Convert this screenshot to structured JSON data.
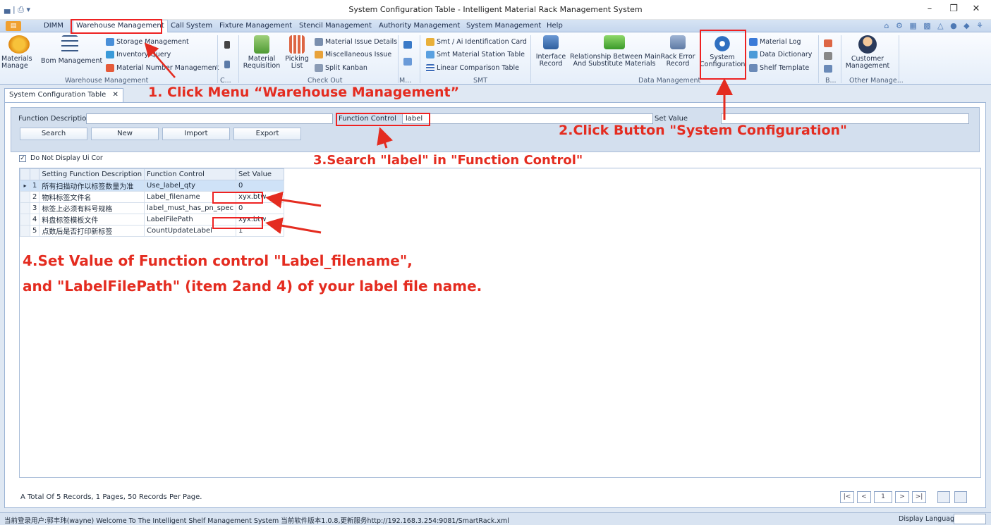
{
  "window": {
    "title": "System Configuration Table - Intelligent Material Rack Management System",
    "quick_access": "▄ | ⎙ ▾",
    "minimize": "–",
    "maximize": "❐",
    "close": "✕"
  },
  "menu": {
    "file": "▤",
    "items": [
      "DIMM",
      "Warehouse Management",
      "Call System",
      "Fixture Management",
      "Stencil Management",
      "Authority Management",
      "System Management",
      "Help"
    ],
    "right_icons": "⌂ ⚙ ▦ ▩ △ ● ◆ ⚘"
  },
  "ribbon": {
    "materials_manage": "Materials\nManage",
    "bom_management": "Bom Management",
    "storage_management": "Storage Management",
    "inventory_query": "Inventory Query",
    "material_number_management": "Material Number Management",
    "group_warehouse": "Warehouse Management",
    "group_c": "C...",
    "material_requisition": "Material\nRequisition",
    "picking_list": "Picking\nList",
    "material_issue_details": "Material Issue Details",
    "miscellaneous_issue": "Miscellaneous Issue",
    "split_kanban": "Split Kanban",
    "group_checkout": "Check Out",
    "group_m": "M...",
    "smt_ai_card": "Smt / Ai Identification Card",
    "smt_station_table": "Smt Material Station Table",
    "linear_comparison": "Linear Comparison Table",
    "group_smt": "SMT",
    "interface_record": "Interface\nRecord",
    "relationship": "Relationship Between Main\nAnd Substitute Materials",
    "rack_error_record": "Rack Error\nRecord",
    "system_configuration": "System\nConfiguration",
    "group_data": "Data Management",
    "material_log": "Material Log",
    "data_dictionary": "Data Dictionary",
    "shelf_template": "Shelf Template",
    "group_b": "B...",
    "customer_management": "Customer\nManagement",
    "group_other": "Other Manage..."
  },
  "doc_tab": {
    "label": "System Configuration Table",
    "close": "✕"
  },
  "search": {
    "function_description_label": "Function Description",
    "function_description_value": "",
    "function_control_label": "Function Control",
    "function_control_value": "label",
    "set_value_label": "Set Value",
    "set_value_value": "",
    "search_btn": "Search",
    "new_btn": "New",
    "import_btn": "Import",
    "export_btn": "Export"
  },
  "checkbox": {
    "label": "Do Not Display Ui Cor",
    "checked": "✓"
  },
  "table": {
    "headers": [
      "Setting Function Description",
      "Function Control",
      "Set Value"
    ],
    "rows": [
      {
        "marker": "▸",
        "num": "1",
        "desc": "所有扫描动作以标签数量为准",
        "control": "Use_label_qty",
        "value": "0"
      },
      {
        "marker": "",
        "num": "2",
        "desc": "物料标签文件名",
        "control": "Label_filename",
        "value": "xyx.btw"
      },
      {
        "marker": "",
        "num": "3",
        "desc": "标签上必须有料号规格",
        "control": "label_must_has_pn_spec",
        "value": "0"
      },
      {
        "marker": "",
        "num": "4",
        "desc": "料盘标签模板文件",
        "control": "LabelFilePath",
        "value": "xyx.btw"
      },
      {
        "marker": "",
        "num": "5",
        "desc": "点数后是否打印新标签",
        "control": "CountUpdateLabel",
        "value": "1"
      }
    ]
  },
  "footer": {
    "records_text": "A Total Of 5 Records, 1 Pages, 50 Records Per Page.",
    "first": "|<",
    "prev": "<",
    "page": "1",
    "next": ">",
    "last": ">|"
  },
  "status": {
    "text": "当前登录用户:郭丰玮(wayne)  Welcome To The Intelligent Shelf Management System  当前软件版本1.0.8,更新服务http://192.168.3.254:9081/SmartRack.xml",
    "display_language": "Display Language"
  },
  "annotations": {
    "step1": "1. Click Menu  “Warehouse Management”",
    "step2": "2.Click Button \"System Configuration\"",
    "step3": "3.Search \"label\" in \"Function Control\"",
    "step4_line1": "4.Set Value of Function control \"Label_filename\",",
    "step4_line2": "and \"LabelFilePath\" (item 2and 4) of your label file name."
  },
  "colors": {
    "annotation_red": "#e42c20",
    "ribbon_bg": "#e5eef9",
    "selected_row": "#cfe2f7"
  }
}
